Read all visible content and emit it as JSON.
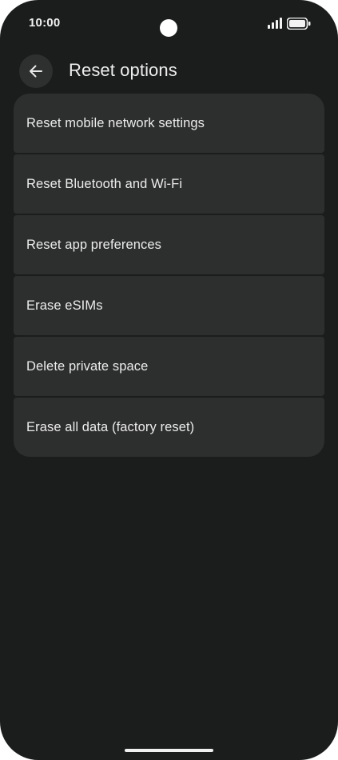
{
  "status_bar": {
    "time": "10:00",
    "signal_icon": "cellular-signal-icon",
    "battery_icon": "battery-full-icon"
  },
  "app_bar": {
    "back_icon": "arrow-left-icon",
    "title": "Reset options"
  },
  "options": [
    {
      "label": "Reset mobile network settings"
    },
    {
      "label": "Reset Bluetooth and Wi-Fi"
    },
    {
      "label": "Reset app preferences"
    },
    {
      "label": "Erase eSIMs"
    },
    {
      "label": "Delete private space"
    },
    {
      "label": "Erase all data (factory reset)"
    }
  ],
  "colors": {
    "background": "#1b1d1c",
    "card": "#2d2f2e",
    "text": "#ececec"
  }
}
